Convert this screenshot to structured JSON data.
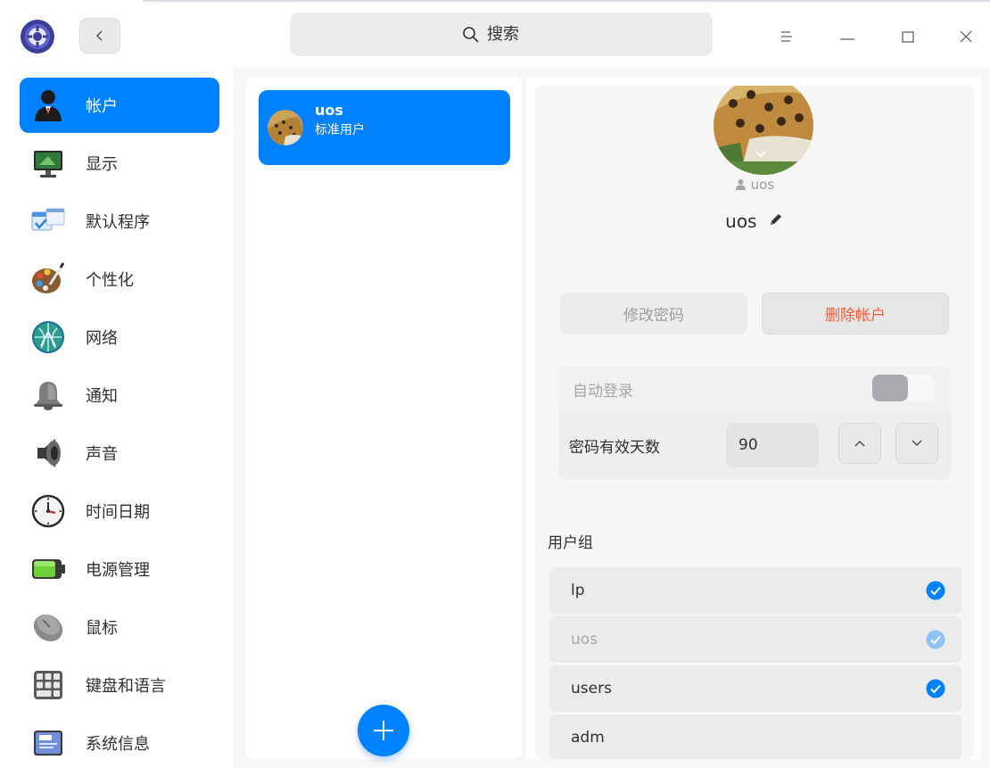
{
  "search": {
    "placeholder": "搜索"
  },
  "nav": {
    "items": [
      {
        "label": "帐户",
        "icon": "account-icon"
      },
      {
        "label": "显示",
        "icon": "display-icon"
      },
      {
        "label": "默认程序",
        "icon": "default-apps-icon"
      },
      {
        "label": "个性化",
        "icon": "personalization-icon"
      },
      {
        "label": "网络",
        "icon": "network-icon"
      },
      {
        "label": "通知",
        "icon": "notification-icon"
      },
      {
        "label": "声音",
        "icon": "sound-icon"
      },
      {
        "label": "时间日期",
        "icon": "clock-icon"
      },
      {
        "label": "电源管理",
        "icon": "battery-icon"
      },
      {
        "label": "鼠标",
        "icon": "mouse-icon"
      },
      {
        "label": "键盘和语言",
        "icon": "keyboard-icon"
      },
      {
        "label": "系统信息",
        "icon": "system-info-icon"
      }
    ]
  },
  "user_list": {
    "selected": {
      "name": "uos",
      "type": "标准用户"
    }
  },
  "detail": {
    "account_id": "uos",
    "full_name": "uos",
    "change_password": "修改密码",
    "delete_account": "删除帐户",
    "auto_login": {
      "label": "自动登录",
      "on": false
    },
    "password_days": {
      "label": "密码有效天数",
      "value": "90"
    },
    "groups_title": "用户组",
    "groups": [
      {
        "name": "lp",
        "checked": true,
        "disabled": false
      },
      {
        "name": "uos",
        "checked": true,
        "disabled": true
      },
      {
        "name": "users",
        "checked": true,
        "disabled": false
      },
      {
        "name": "adm",
        "checked": false,
        "disabled": false
      }
    ]
  },
  "colors": {
    "accent": "#0081ff",
    "danger": "#ff5a36"
  }
}
